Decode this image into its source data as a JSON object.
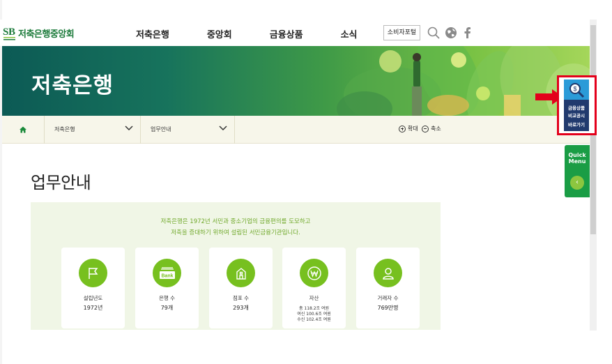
{
  "header": {
    "logo_text": "저축은행중앙회",
    "nav": [
      "저축은행",
      "중앙회",
      "금융상품",
      "소식"
    ],
    "consumer_portal": "소비자포털"
  },
  "banner": {
    "title": "저축은행"
  },
  "breadcrumb": {
    "level1": "저축은행",
    "level2": "업무안내",
    "zoom_in": "확대",
    "zoom_out": "축소"
  },
  "page": {
    "title": "업무안내",
    "intro_line1": "저축은행은 1972년 서민과 중소기업의 금융편의를 도모하고",
    "intro_line2": "저축을 증대하기 위하여 설립된 서민금융기관입니다."
  },
  "stats": [
    {
      "label": "설립년도",
      "value": "1972년",
      "icon": "flag-icon"
    },
    {
      "label": "은행 수",
      "value": "79개",
      "icon": "bank-icon",
      "icon_text": "Bank"
    },
    {
      "label": "점포 수",
      "value": "293개",
      "icon": "building-icon"
    },
    {
      "label": "자산",
      "value": "",
      "icon": "won-icon",
      "details": [
        "총 118.2조 여원",
        "여신 100.6조 여원",
        "수신 102.4조 여원"
      ]
    },
    {
      "label": "거래자 수",
      "value": "769만명",
      "icon": "person-icon"
    }
  ],
  "side": {
    "compare_line1": "금융상품",
    "compare_line2": "비교공시",
    "compare_line3": "바로가기",
    "quick_menu": "Quick\nMenu"
  },
  "colors": {
    "brand_green": "#1b7a3a",
    "accent_green": "#77c01f",
    "highlight_red": "#e3001b",
    "quick_green": "#1a9d45"
  }
}
